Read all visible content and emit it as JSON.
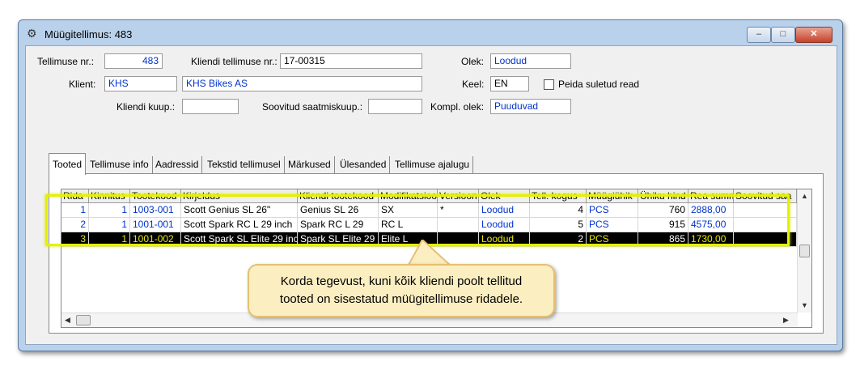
{
  "window": {
    "title": "Müügitellimus: 483",
    "min_label": "–",
    "max_label": "□",
    "close_label": "✕",
    "icon": "gear-icon"
  },
  "form": {
    "order_nr_label": "Tellimuse nr.:",
    "order_nr_value": "483",
    "client_order_nr_label": "Kliendi tellimuse nr.:",
    "client_order_nr_value": "17-00315",
    "status_label": "Olek:",
    "status_value": "Loodud",
    "client_label": "Klient:",
    "client_code": "KHS",
    "client_name": "KHS Bikes AS",
    "language_label": "Keel:",
    "language_value": "EN",
    "hide_closed_label": "Peida suletud read",
    "client_date_label": "Kliendi kuup.:",
    "client_date_value": "",
    "wished_date_label": "Soovitud saatmiskuup.:",
    "wished_date_value": "",
    "compl_status_label": "Kompl. olek:",
    "compl_status_value": "Puuduvad"
  },
  "tabs": [
    "Tooted",
    "Tellimuse info",
    "Aadressid",
    "Tekstid tellimusel",
    "Märkused",
    "Ülesanded",
    "Tellimuse ajalugu"
  ],
  "grid": {
    "columns": [
      "Rida",
      "Kinnitus",
      "Tootekood",
      "Kirjeldus",
      "Kliendi tootekood",
      "Modifikatsioo",
      "Versioon",
      "Olek",
      "Tell. kogus",
      "Müügiühik",
      "Ühiku hind",
      "Rea summ",
      "Soovitud saa"
    ],
    "rows": [
      {
        "rida": "1",
        "kinnitus": "1",
        "tootekood": "1003-001",
        "kirjeldus": "Scott Genius SL 26\"",
        "kliendi_tootekood": "Genius SL 26",
        "modifikatsioon": "SX",
        "versioon": "*",
        "olek": "Loodud",
        "kogus": "4",
        "uhik": "PCS",
        "hind": "760",
        "summa": "2888,00",
        "soovitud": ""
      },
      {
        "rida": "2",
        "kinnitus": "1",
        "tootekood": "1001-001",
        "kirjeldus": "Scott Spark RC L 29 inch",
        "kliendi_tootekood": "Spark RC L 29",
        "modifikatsioon": "RC L",
        "versioon": "",
        "olek": "Loodud",
        "kogus": "5",
        "uhik": "PCS",
        "hind": "915",
        "summa": "4575,00",
        "soovitud": ""
      },
      {
        "rida": "3",
        "kinnitus": "1",
        "tootekood": "1001-002",
        "kirjeldus": "Scott Spark SL Elite 29 inc",
        "kliendi_tootekood": "Spark SL Elite 29",
        "modifikatsioon": "Elite L",
        "versioon": "",
        "olek": "Loodud",
        "kogus": "2",
        "uhik": "PCS",
        "hind": "865",
        "summa": "1730,00",
        "soovitud": ""
      }
    ]
  },
  "callout": {
    "line1": "Korda tegevust, kuni kõik kliendi poolt tellitud",
    "line2": "tooted on sisestatud müügitellimuse ridadele."
  },
  "colors": {
    "highlight": "#e6f000",
    "callout_bg": "#fbeec1",
    "link_blue": "#0033cc",
    "selected_row": "#000000"
  }
}
